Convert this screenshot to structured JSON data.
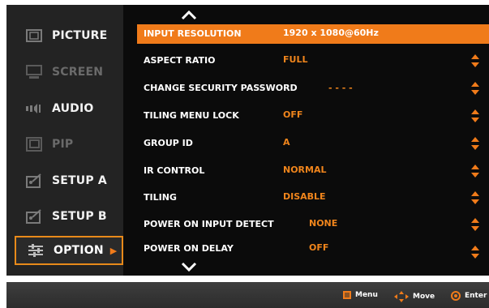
{
  "sidebar": {
    "items": [
      {
        "label": "PICTURE",
        "icon": "picture-icon",
        "state": "normal"
      },
      {
        "label": "SCREEN",
        "icon": "screen-icon",
        "state": "disabled"
      },
      {
        "label": "AUDIO",
        "icon": "audio-icon",
        "state": "normal"
      },
      {
        "label": "PIP",
        "icon": "pip-icon",
        "state": "disabled"
      },
      {
        "label": "SETUP A",
        "icon": "setup-icon",
        "state": "normal"
      },
      {
        "label": "SETUP B",
        "icon": "setup-icon",
        "state": "normal"
      },
      {
        "label": "OPTION",
        "icon": "option-sliders-icon",
        "state": "active"
      }
    ]
  },
  "menu": {
    "rows": [
      {
        "key": "INPUT RESOLUTION",
        "value": "1920 x 1080@60Hz",
        "selected": true,
        "adjustable": false
      },
      {
        "key": "ASPECT RATIO",
        "value": "FULL",
        "selected": false,
        "adjustable": true
      },
      {
        "key": "CHANGE SECURITY PASSWORD",
        "value": "- - - -",
        "selected": false,
        "adjustable": true
      },
      {
        "key": "TILING MENU LOCK",
        "value": "OFF",
        "selected": false,
        "adjustable": true
      },
      {
        "key": "GROUP ID",
        "value": "A",
        "selected": false,
        "adjustable": true
      },
      {
        "key": "IR CONTROL",
        "value": "NORMAL",
        "selected": false,
        "adjustable": true
      },
      {
        "key": "TILING",
        "value": "DISABLE",
        "selected": false,
        "adjustable": true
      },
      {
        "key": "POWER ON INPUT DETECT",
        "value": "NONE",
        "selected": false,
        "adjustable": true
      },
      {
        "key": "POWER ON DELAY",
        "value": "OFF",
        "selected": false,
        "adjustable": true
      }
    ]
  },
  "hints": {
    "menu": "Menu",
    "move": "Move",
    "enter": "Enter"
  },
  "colors": {
    "accent": "#f07b1a",
    "value_text": "#f0851c",
    "panel": "#0b0b0b"
  }
}
